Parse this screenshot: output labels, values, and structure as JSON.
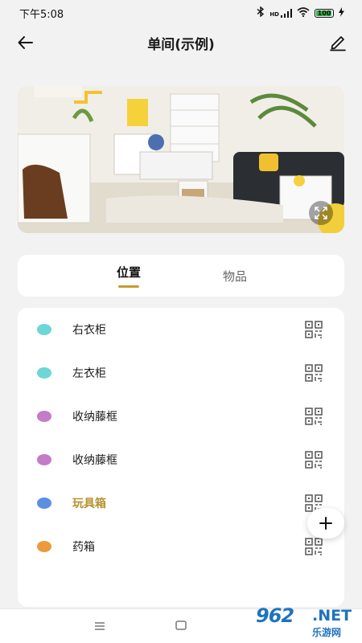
{
  "status_bar": {
    "time": "下午5:08",
    "network": "HD",
    "battery_level": "100"
  },
  "header": {
    "title": "单间(示例)"
  },
  "tabs": [
    {
      "label": "位置",
      "active": true
    },
    {
      "label": "物品",
      "active": false
    }
  ],
  "items": [
    {
      "label": "右衣柜",
      "color": "#6dd6d6"
    },
    {
      "label": "左衣柜",
      "color": "#6dd6d6"
    },
    {
      "label": "收纳藤框",
      "color": "#c47bc9"
    },
    {
      "label": "收纳藤框",
      "color": "#c47bc9"
    },
    {
      "label": "玩具箱",
      "color": "#5b8fe0",
      "active": true
    },
    {
      "label": "药箱",
      "color": "#ec9a3a"
    }
  ],
  "watermark": {
    "number": "962",
    "suffix": ".NET",
    "site": "乐游网"
  },
  "colors": {
    "accent": "#c99a2e",
    "active_text": "#b8912f",
    "background": "#f2f2f2"
  }
}
